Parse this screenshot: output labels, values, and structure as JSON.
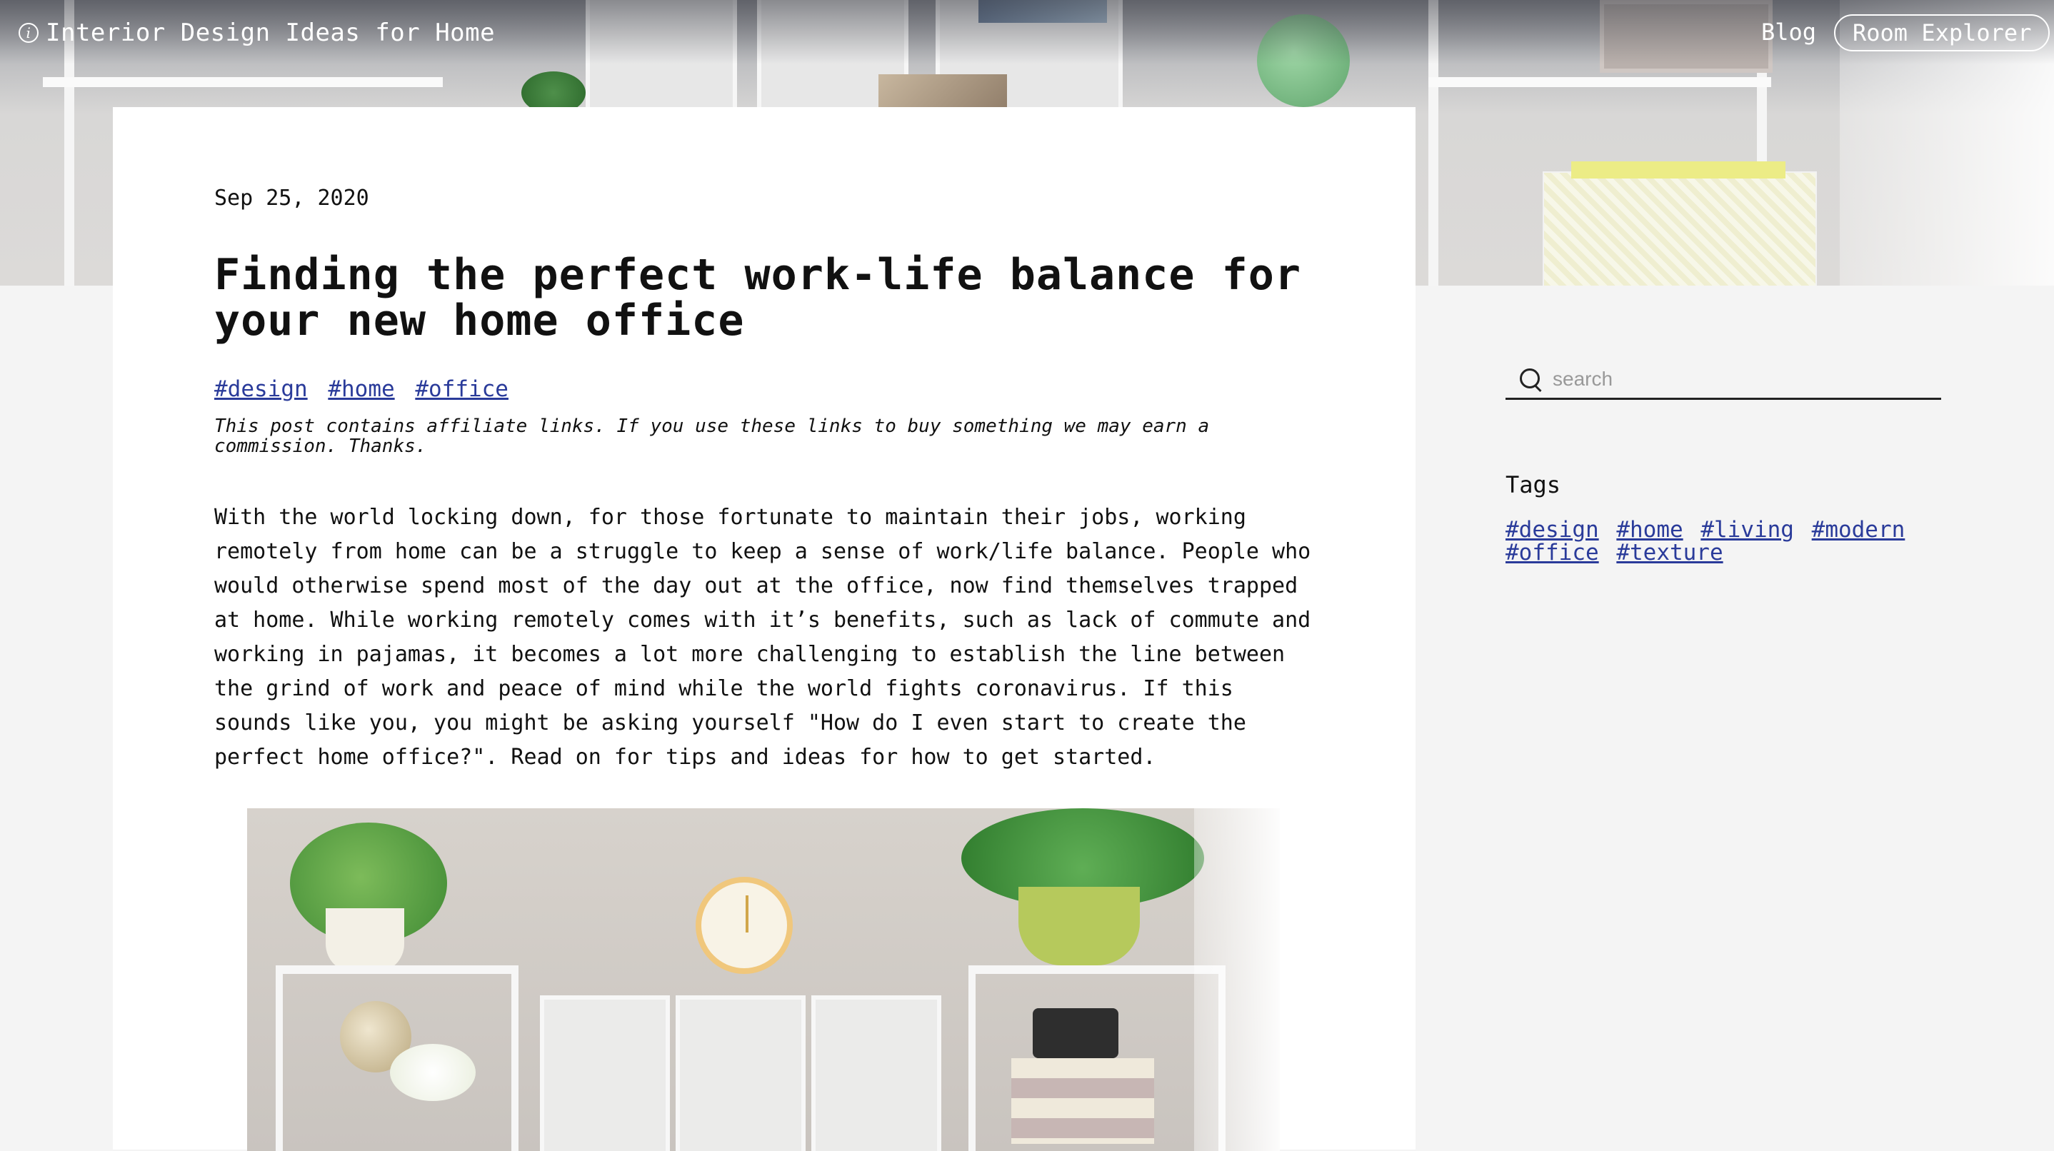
{
  "header": {
    "site_title": "Interior Design Ideas for Home",
    "nav": {
      "blog": "Blog",
      "room_explorer": "Room Explorer"
    }
  },
  "article": {
    "date": "Sep 25, 2020",
    "title": "Finding the perfect work-life balance for your new home office",
    "tags": [
      "#design",
      "#home",
      "#office"
    ],
    "disclaimer": "This post contains affiliate links. If you use these links to buy something we may earn a commission. Thanks.",
    "body": "With the world locking down, for those fortunate to maintain their jobs, working remotely from home can be a struggle to keep a sense of work/life balance. People who would otherwise spend most of the day out at the office, now find themselves trapped at home. While working remotely comes with it’s benefits, such as lack of commute and working in pajamas, it becomes a lot more challenging to establish the line between the grind of work and peace of mind while the world fights coronavirus. If this sounds like you, you might be asking yourself \"How do I even start to create the perfect home office?\". Read on for tips and ideas for how to get started."
  },
  "sidebar": {
    "search": {
      "placeholder": "search"
    },
    "tags_heading": "Tags",
    "tags": [
      "#design",
      "#home",
      "#living",
      "#modern",
      "#office",
      "#texture"
    ]
  },
  "colors": {
    "link": "#2a3b9a",
    "page_background": "#f4f4f4",
    "card_background": "#ffffff"
  },
  "icons": {
    "info": "info-icon",
    "search": "search-icon"
  }
}
